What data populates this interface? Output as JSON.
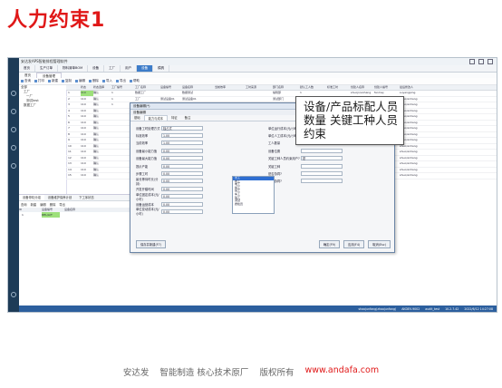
{
  "slide": {
    "title": "人力约束1"
  },
  "app": {
    "window_title": "安达发APS智能排程管理软件",
    "menu": [
      "首页",
      "生产订单",
      "物料清单BOM",
      "设备",
      "工厂",
      "用户",
      "设备",
      "模具"
    ],
    "active_menu": 6,
    "subtabs": [
      "首页",
      "设备管理"
    ],
    "active_subtab": 1,
    "toolbar": [
      "查询",
      "打印",
      "新建",
      "复制",
      "编辑",
      "删除",
      "导入",
      "导出",
      "帮助"
    ],
    "tree": [
      "全部",
      "工厂",
      "一厂",
      "测试test",
      "数据工厂"
    ],
    "grid": {
      "headers": [
        "",
        "状态",
        "状态选择",
        "工厂编号",
        "工厂名称",
        "设备编号",
        "设备名称",
        "当前效率",
        "工时来源",
        "部门名称",
        "默认工人数",
        "标准工时",
        "创建人名称",
        "创建人编号",
        "最后修改人"
      ],
      "rows": [
        {
          "n": "1",
          "code": "110",
          "st": "确认",
          "f": "1",
          "fname": "数据工厂",
          "dno": "",
          "dname": "数据测试",
          "eff": "",
          "src": "",
          "dept": "编辑部",
          "w": "1",
          "h": "",
          "cn": "shuojn/anhang",
          "cno": "fanmej",
          "mn": "suyangping"
        },
        {
          "n": "2",
          "code": "110",
          "st": "确认",
          "f": "1",
          "fname": "工厂",
          "dno": "测试设备01",
          "dname": "测试设备01",
          "eff": "",
          "src": "",
          "dept": "测试部门",
          "w": "1",
          "h": "",
          "cn": "shuojn/anhang",
          "cno": "shuo/anhang",
          "mn": "shuo/anhang"
        },
        {
          "n": "3",
          "code": "110",
          "st": "确认",
          "f": "1",
          "fname": "",
          "dno": "",
          "dname": "",
          "eff": "",
          "src": "",
          "dept": "",
          "w": "",
          "h": "",
          "cn": "shuo/anhang",
          "cno": "shuo/anhang",
          "mn": "shuo/anhang"
        },
        {
          "n": "4",
          "code": "110",
          "st": "确认",
          "f": "",
          "fname": "",
          "dno": "",
          "dname": "",
          "eff": "",
          "src": "",
          "dept": "",
          "w": "",
          "h": "",
          "cn": "shuo/anhang",
          "cno": "shuo/anhang",
          "mn": "shuo/anhang"
        },
        {
          "n": "5",
          "code": "110",
          "st": "确认",
          "f": "",
          "fname": "",
          "dno": "",
          "dname": "",
          "eff": "",
          "src": "",
          "dept": "",
          "w": "",
          "h": "",
          "cn": "shuo/anhang",
          "cno": "shuo/anhang",
          "mn": "shuo/anhang"
        },
        {
          "n": "6",
          "code": "110",
          "st": "确认",
          "f": "",
          "fname": "",
          "dno": "",
          "dname": "",
          "eff": "",
          "src": "",
          "dept": "",
          "w": "",
          "h": "",
          "cn": "shuo/anhang",
          "cno": "shuo/anhang",
          "mn": "shuo/anhang"
        },
        {
          "n": "7",
          "code": "110",
          "st": "确认",
          "f": "",
          "fname": "",
          "dno": "",
          "dname": "",
          "eff": "",
          "src": "",
          "dept": "",
          "w": "",
          "h": "",
          "cn": "shuo/anhang",
          "cno": "shuo/anhang",
          "mn": "shuo/anhang"
        },
        {
          "n": "8",
          "code": "110",
          "st": "确认",
          "f": "",
          "fname": "",
          "dno": "",
          "dname": "",
          "eff": "",
          "src": "",
          "dept": "",
          "w": "",
          "h": "",
          "cn": "shuo/anhang",
          "cno": "shuo/anhang",
          "mn": "shuo/anhang"
        },
        {
          "n": "9",
          "code": "110",
          "st": "确认",
          "f": "",
          "fname": "",
          "dno": "",
          "dname": "",
          "eff": "",
          "src": "",
          "dept": "",
          "w": "",
          "h": "",
          "cn": "shuo/anhang",
          "cno": "shuo/anhang",
          "mn": "shuo/anhang"
        },
        {
          "n": "10",
          "code": "110",
          "st": "确认",
          "f": "",
          "fname": "",
          "dno": "",
          "dname": "",
          "eff": "",
          "src": "",
          "dept": "",
          "w": "",
          "h": "",
          "cn": "shuo/anhang",
          "cno": "shuo/anhang",
          "mn": "shuo/anhang"
        },
        {
          "n": "11",
          "code": "110",
          "st": "确认",
          "f": "",
          "fname": "",
          "dno": "",
          "dname": "",
          "eff": "",
          "src": "",
          "dept": "",
          "w": "",
          "h": "",
          "cn": "shuo/anhang",
          "cno": "shuo/anhang",
          "mn": "shuo/anhang"
        },
        {
          "n": "12",
          "code": "110",
          "st": "确认",
          "f": "",
          "fname": "",
          "dno": "",
          "dname": "",
          "eff": "",
          "src": "",
          "dept": "",
          "w": "",
          "h": "",
          "cn": "shuo/anhang",
          "cno": "shuo/anhang",
          "mn": "shuo/anhang"
        },
        {
          "n": "13",
          "code": "110",
          "st": "确认",
          "f": "",
          "fname": "",
          "dno": "",
          "dname": "",
          "eff": "",
          "src": "",
          "dept": "",
          "w": "",
          "h": "",
          "cn": "shuo/anhang",
          "cno": "shuo/anhang",
          "mn": "shuo/anhang"
        },
        {
          "n": "14",
          "code": "110",
          "st": "确认",
          "f": "",
          "fname": "",
          "dno": "",
          "dname": "",
          "eff": "",
          "src": "",
          "dept": "",
          "w": "",
          "h": "",
          "cn": "shuo/anhang",
          "cno": "shuo/anhang",
          "mn": "shuo/anhang"
        },
        {
          "n": "15",
          "code": "110",
          "st": "确认",
          "f": "",
          "fname": "",
          "dno": "",
          "dname": "",
          "eff": "",
          "src": "",
          "dept": "",
          "w": "",
          "h": "",
          "cn": "shuo/anhang",
          "cno": "shuo/anhang",
          "mn": "shuo/anhang"
        }
      ]
    },
    "bottom": {
      "tabs": [
        "设备停机分组",
        "设备维护保养计划",
        "下工序状态"
      ],
      "toolbar": [
        "查询",
        "新建",
        "编辑",
        "删除",
        "导出"
      ],
      "headers": [
        "ID",
        "设备编号",
        "设备名称"
      ],
      "row": {
        "id": "1",
        "val": "DEL/A/T"
      }
    },
    "status": [
      "shaojunfang(zhaojunfang)",
      "AKDEV-9002",
      "audit_test",
      "10.2.7.42",
      "2022/6/12 14:27:08"
    ],
    "dialog": {
      "title": "设备编辑(*)",
      "header": "设备编辑",
      "tabs": [
        "基础",
        "能力与成本",
        "特征",
        "备注"
      ],
      "active_tab": 1,
      "left_fields": [
        {
          "label": "设备工时处理方式",
          "value": "独占式"
        },
        {
          "label": "标准效率",
          "value": "1.00"
        },
        {
          "label": "当前效率",
          "value": "1.00"
        },
        {
          "label": "设备最小能力值",
          "value": "0.00"
        },
        {
          "label": "设备最大能力值",
          "value": "0.00"
        },
        {
          "label": "提示产能",
          "value": "0.00"
        },
        {
          "label": "步骤工时",
          "value": "0.00"
        },
        {
          "label": "最长等待时长(分钟)",
          "value": "0.00"
        },
        {
          "label": "开发开模时间",
          "value": "0.00"
        },
        {
          "label": "单位固定成本(元/小时)",
          "value": "0.00"
        },
        {
          "label": "设备运营成本",
          "value": "0.00"
        },
        {
          "label": "单位变动成本(元/小时)",
          "value": "0.00"
        }
      ],
      "right_fields": [
        {
          "label": "单位运行成本(元/小时)",
          "value": "0.00"
        },
        {
          "label": "单位人工成本(元/小时)",
          "value": "0.00"
        },
        {
          "label": "工人数量",
          "value": "0"
        },
        {
          "label": "设备位置",
          "value": ""
        },
        {
          "label": "关键工种人员约束用户?",
          "value": "是"
        },
        {
          "label": "关键工种",
          "value": ""
        },
        {
          "label": "是否协同?",
          "value": ""
        },
        {
          "label": "是否协同?",
          "value": ""
        }
      ],
      "dropdown": [
        "普工",
        "技工",
        "电工",
        "焊工",
        "钳工",
        "车工",
        "铣工",
        "调试",
        "质检员"
      ],
      "dropdown_selected": 0,
      "left_button": "保存并新建(F7)",
      "buttons": [
        "确定(F9)",
        "应用(F4)",
        "取消(Esc)"
      ]
    }
  },
  "callout": {
    "text": "设备/产品标配人员数量 关键工种人员约束"
  },
  "footer": [
    "安达发",
    "智能制造 核心技术原厂",
    "版权所有",
    "www.andafa.com"
  ]
}
